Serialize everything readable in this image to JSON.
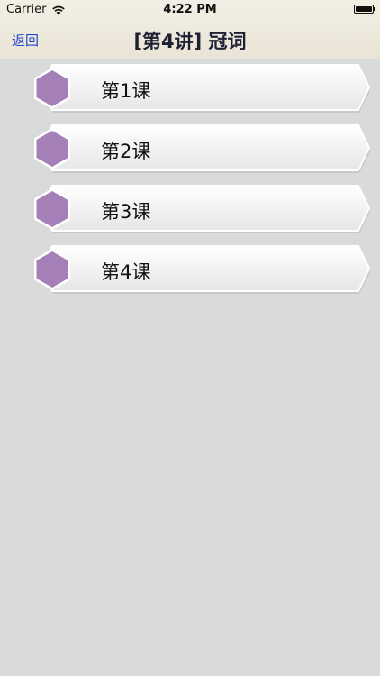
{
  "status": {
    "carrier": "Carrier",
    "time": "4:22 PM"
  },
  "nav": {
    "back_label": "返回",
    "title": "[第4讲] 冠词"
  },
  "lessons": [
    {
      "label": "第1课"
    },
    {
      "label": "第2课"
    },
    {
      "label": "第3课"
    },
    {
      "label": "第4课"
    }
  ],
  "colors": {
    "background": "#d9dbda",
    "hexagon": "#a57fb8",
    "back_link": "#1d49c9"
  }
}
